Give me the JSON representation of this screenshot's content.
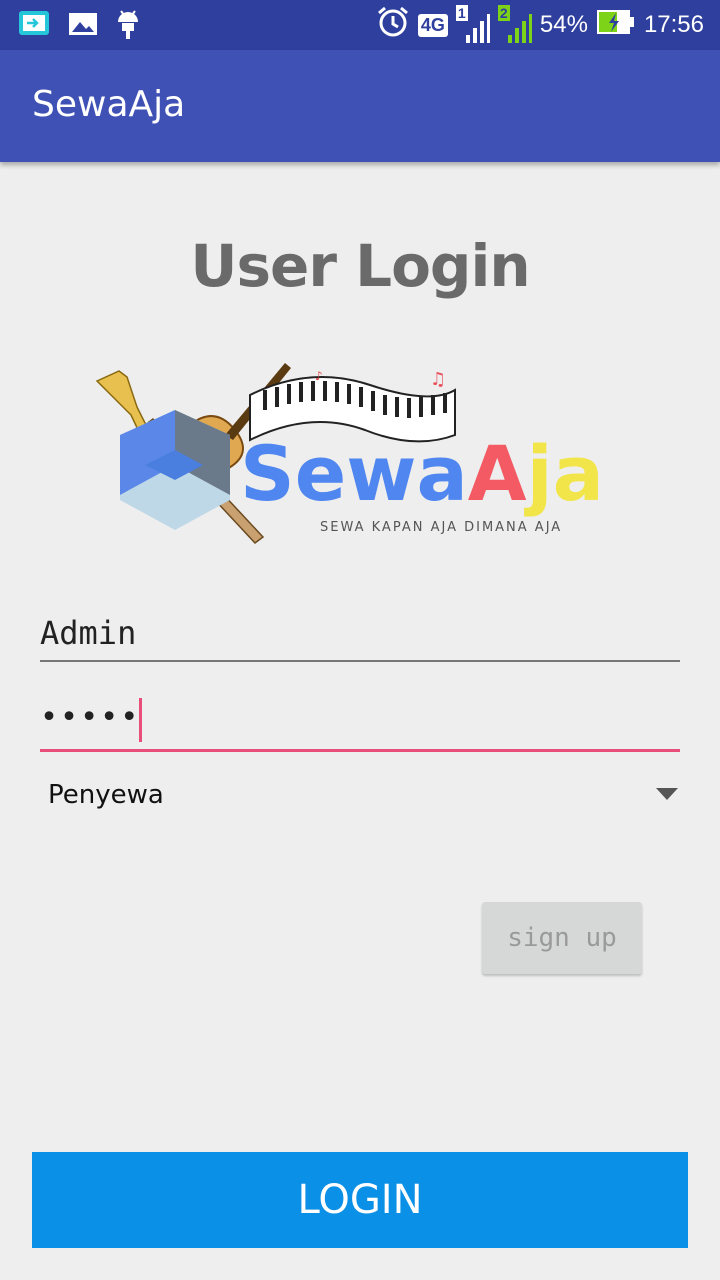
{
  "status_bar": {
    "network": "4G",
    "sim1": "1",
    "sim2": "2",
    "battery": "54%",
    "time": "17:56",
    "icons": [
      "screen-cast-icon",
      "image-icon",
      "android-icon",
      "alarm-icon",
      "signal-icon",
      "battery-charging-icon"
    ]
  },
  "appbar": {
    "title": "SewaAja"
  },
  "page": {
    "heading": "User Login"
  },
  "logo": {
    "brand_sewa": "Sewa",
    "brand_a": "A",
    "brand_ja": "ja",
    "tagline": "SEWA KAPAN AJA DIMANA AJA"
  },
  "form": {
    "username": "Admin",
    "password": "•••••",
    "role_selected": "Penyewa"
  },
  "buttons": {
    "signup": "sign up",
    "login": "LOGIN"
  },
  "colors": {
    "primary": "#3f51b5",
    "primary_dark": "#2f3f9e",
    "accent": "#e94e7b",
    "login": "#0a90e6"
  }
}
